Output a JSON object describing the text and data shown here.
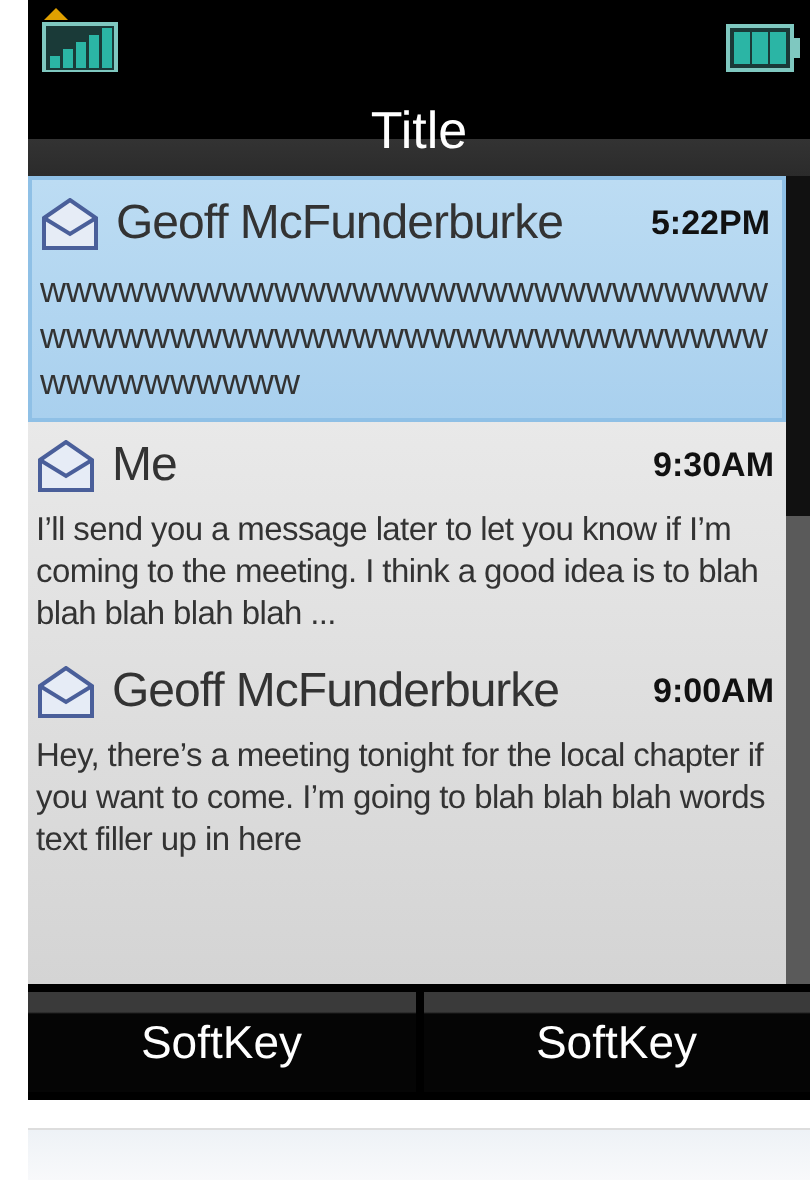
{
  "status_bar": {
    "roaming": true
  },
  "title": "Title",
  "messages": [
    {
      "sender": "Geoff McFunderburke",
      "time": "5:22PM",
      "preview": "wwwwwwwwwwwwwwwwwwwwwwwwwwwwwwwwwwwwwwwwwwwwwwwwwwwwwwwwwwwwwwwwww",
      "selected": true
    },
    {
      "sender": "Me",
      "time": "9:30AM",
      "preview": "I’ll send you a message later to let you know if I’m coming to the meeting. I think a good idea is to blah blah blah blah blah ...",
      "selected": false
    },
    {
      "sender": "Geoff McFunderburke",
      "time": "9:00AM",
      "preview": "Hey, there’s a meeting tonight for the local chapter if you want to come. I’m going to blah blah blah words text filler up in here",
      "selected": false
    }
  ],
  "softkeys": [
    "SoftKey",
    "SoftKey"
  ]
}
